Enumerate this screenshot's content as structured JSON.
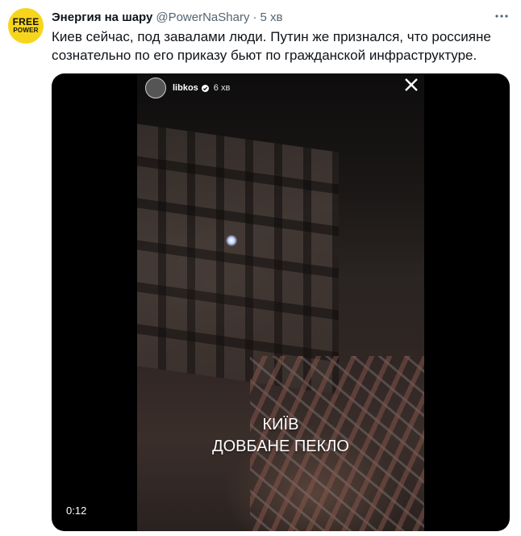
{
  "tweet": {
    "avatar": {
      "line1": "FREE",
      "line2": "POWER",
      "color": "#f7d51d"
    },
    "display_name": "Энергия на шару",
    "handle": "@PowerNaShary",
    "separator": "·",
    "time": "5 хв",
    "more_icon": "more-horizontal-icon",
    "text": "Киев сейчас, под завалами люди. Путин же признался, что россияне сознательно по его приказу бьют по гражданской инфраструктуре."
  },
  "media": {
    "story_user": "libkos",
    "verified_icon": "verified-badge-icon",
    "story_time": "6 хв",
    "close_icon": "close-icon",
    "caption_line1": "КИЇВ",
    "caption_line2": "ДОВБАНЕ ПЕКЛО",
    "duration": "0:12"
  },
  "colors": {
    "text_primary": "#0f1419",
    "text_secondary": "#536471",
    "media_background": "#000000"
  }
}
